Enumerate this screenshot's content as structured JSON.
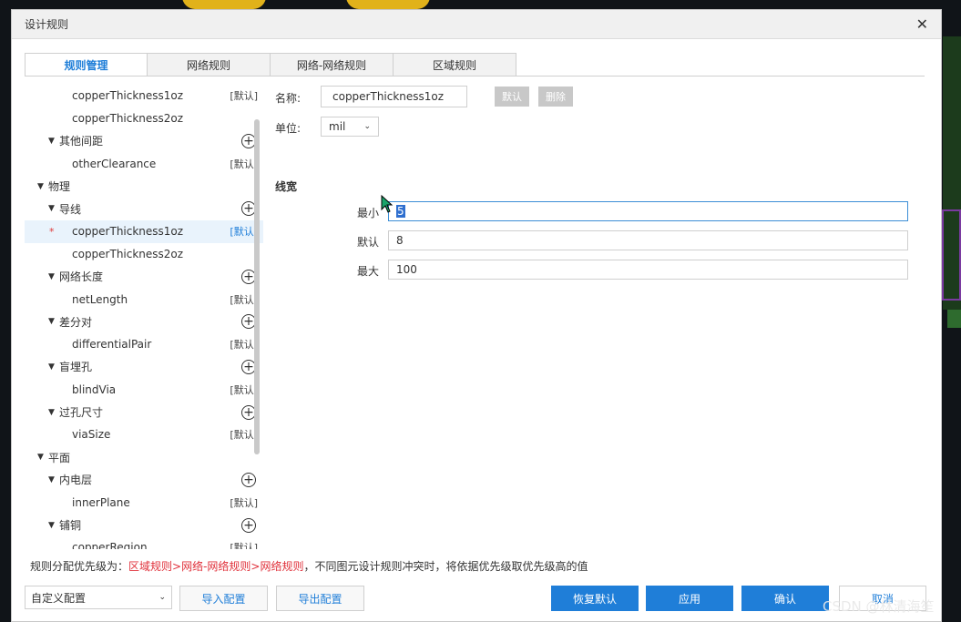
{
  "window": {
    "title": "设计规则"
  },
  "tabs": [
    {
      "label": "规则管理",
      "active": true
    },
    {
      "label": "网络规则",
      "active": false
    },
    {
      "label": "网络-网络规则",
      "active": false
    },
    {
      "label": "区域规则",
      "active": false
    }
  ],
  "tree": [
    {
      "label": "copperThickness1oz",
      "indent": 2,
      "badge": "[默认]"
    },
    {
      "label": "copperThickness2oz",
      "indent": 2,
      "badge": ""
    },
    {
      "label": "其他间距",
      "indent": 1,
      "arrow": true,
      "add": true
    },
    {
      "label": "otherClearance",
      "indent": 2,
      "badge": "[默认]"
    },
    {
      "label": "物理",
      "indent": 0,
      "arrow": true
    },
    {
      "label": "导线",
      "indent": 1,
      "arrow": true,
      "add": true
    },
    {
      "label": "copperThickness1oz",
      "indent": 2,
      "badge": "[默认]",
      "selected": true,
      "star": "*"
    },
    {
      "label": "copperThickness2oz",
      "indent": 2,
      "badge": ""
    },
    {
      "label": "网络长度",
      "indent": 1,
      "arrow": true,
      "add": true
    },
    {
      "label": "netLength",
      "indent": 2,
      "badge": "[默认]"
    },
    {
      "label": "差分对",
      "indent": 1,
      "arrow": true,
      "add": true
    },
    {
      "label": "differentialPair",
      "indent": 2,
      "badge": "[默认]"
    },
    {
      "label": "盲埋孔",
      "indent": 1,
      "arrow": true,
      "add": true
    },
    {
      "label": "blindVia",
      "indent": 2,
      "badge": "[默认]"
    },
    {
      "label": "过孔尺寸",
      "indent": 1,
      "arrow": true,
      "add": true
    },
    {
      "label": "viaSize",
      "indent": 2,
      "badge": "[默认]"
    },
    {
      "label": "平面",
      "indent": 0,
      "arrow": true
    },
    {
      "label": "内电层",
      "indent": 1,
      "arrow": true,
      "add": true
    },
    {
      "label": "innerPlane",
      "indent": 2,
      "badge": "[默认]"
    },
    {
      "label": "铺铜",
      "indent": 1,
      "arrow": true,
      "add": true
    },
    {
      "label": "copperRegion",
      "indent": 2,
      "badge": "[默认]"
    }
  ],
  "form": {
    "name_label": "名称:",
    "name_value": "copperThickness1oz",
    "default_btn": "默认",
    "delete_btn": "删除",
    "unit_label": "单位:",
    "unit_value": "mil",
    "section_title": "线宽",
    "min_label": "最小",
    "min_value": "5",
    "default_label": "默认",
    "default_value": "8",
    "max_label": "最大",
    "max_value": "100"
  },
  "footer": {
    "note_prefix": "规则分配优先级为：",
    "note_red": "区域规则>网络-网络规则>网络规则",
    "note_suffix": "，不同图元设计规则冲突时，将依据优先级取优先级高的值",
    "config_select": "自定义配置",
    "import_btn": "导入配置",
    "export_btn": "导出配置",
    "restore_btn": "恢复默认",
    "apply_btn": "应用",
    "confirm_btn": "确认",
    "cancel_btn": "取消"
  },
  "watermark": "CSDN @林清海笙",
  "colors": {
    "accent": "#1f7ed8",
    "warning_text": "#e0313b",
    "selected_row": "#e9f3fc"
  }
}
